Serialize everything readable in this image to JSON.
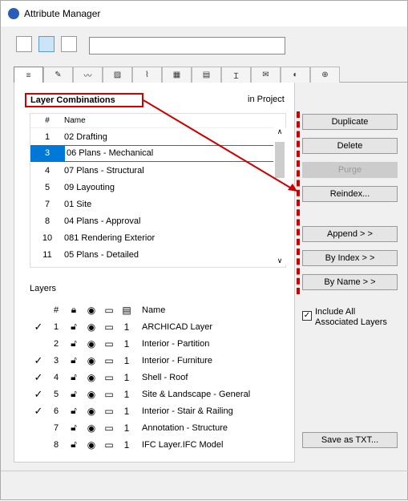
{
  "window": {
    "title": "Attribute Manager"
  },
  "toolbar": {
    "search_value": ""
  },
  "tabs": [
    "layers",
    "pens",
    "lines",
    "fills",
    "composites",
    "surfaces",
    "profiles",
    "zones",
    "markup",
    "mep",
    "global",
    "more"
  ],
  "combo": {
    "title": "Layer Combinations",
    "in_project": "in Project",
    "col_hash": "#",
    "col_name": "Name",
    "rows": [
      {
        "n": "1",
        "name": "02 Drafting"
      },
      {
        "n": "3",
        "name": "06 Plans - Mechanical"
      },
      {
        "n": "4",
        "name": "07 Plans - Structural"
      },
      {
        "n": "5",
        "name": "09 Layouting"
      },
      {
        "n": "7",
        "name": "01 Site"
      },
      {
        "n": "8",
        "name": "04 Plans - Approval"
      },
      {
        "n": "10",
        "name": "081 Rendering Exterior"
      },
      {
        "n": "11",
        "name": "05 Plans - Detailed"
      }
    ]
  },
  "layers": {
    "label": "Layers",
    "col_hash": "#",
    "col_name": "Name",
    "rows": [
      {
        "check": "✓",
        "n": "1",
        "count": "1",
        "name": "ARCHICAD Layer"
      },
      {
        "check": "",
        "n": "2",
        "count": "1",
        "name": "Interior - Partition"
      },
      {
        "check": "✓",
        "n": "3",
        "count": "1",
        "name": "Interior - Furniture"
      },
      {
        "check": "✓",
        "n": "4",
        "count": "1",
        "name": "Shell - Roof"
      },
      {
        "check": "✓",
        "n": "5",
        "count": "1",
        "name": "Site & Landscape - General"
      },
      {
        "check": "✓",
        "n": "6",
        "count": "1",
        "name": "Interior - Stair & Railing"
      },
      {
        "check": "",
        "n": "7",
        "count": "1",
        "name": "Annotation - Structure"
      },
      {
        "check": "",
        "n": "8",
        "count": "1",
        "name": "IFC Layer.IFC Model"
      }
    ]
  },
  "buttons": {
    "duplicate": "Duplicate",
    "delete": "Delete",
    "purge": "Purge",
    "reindex": "Reindex...",
    "append": "Append > >",
    "by_index": "By Index > >",
    "by_name": "By Name > >",
    "save_txt": "Save as TXT..."
  },
  "include_all": "Include All Associated Layers"
}
